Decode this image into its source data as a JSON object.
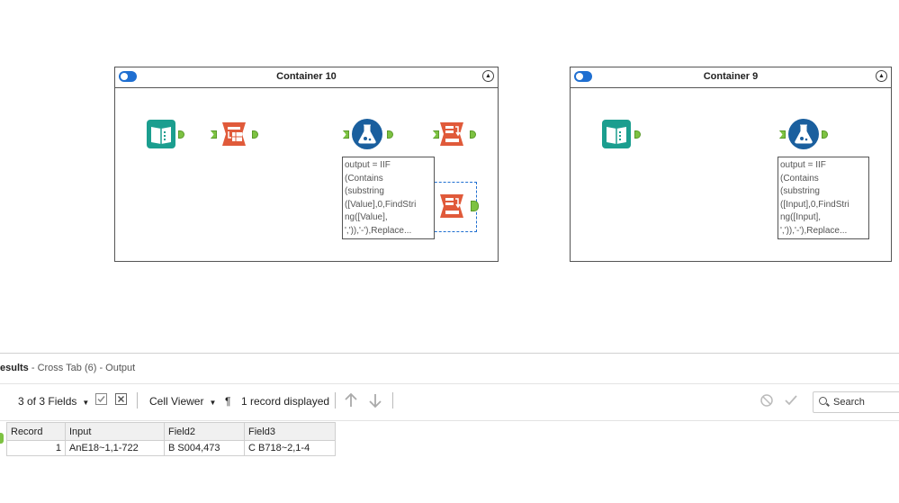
{
  "containers": [
    {
      "title": "Container 10"
    },
    {
      "title": "Container 9"
    }
  ],
  "annotations": {
    "c10": "output = IIF\n(Contains\n(substring\n([Value],0,FindStri\nng([Value],\n',')),'-'),Replace...",
    "c9": "output = IIF\n(Contains\n(substring\n([Input],0,FindStri\nng([Input],\n',')),'-'),Replace..."
  },
  "results": {
    "title_bold": "esults",
    "title_rest": " - Cross Tab (6) - Output",
    "fields_label": "3 of 3 Fields",
    "viewer_label": "Cell Viewer",
    "records_label": "1 record displayed",
    "search_label": "Search"
  },
  "table": {
    "headers": [
      "Record",
      "Input",
      "Field2",
      "Field3"
    ],
    "rows": [
      [
        "1",
        "AnE18~1,1-722",
        "B S004,473",
        "C B718~2,1-4"
      ]
    ]
  },
  "colors": {
    "accent": "#1f6fd1",
    "connector": "#7dc242",
    "teal": "#1b9e8f",
    "red": "#e05a3a",
    "blue": "#1a5f9e"
  }
}
